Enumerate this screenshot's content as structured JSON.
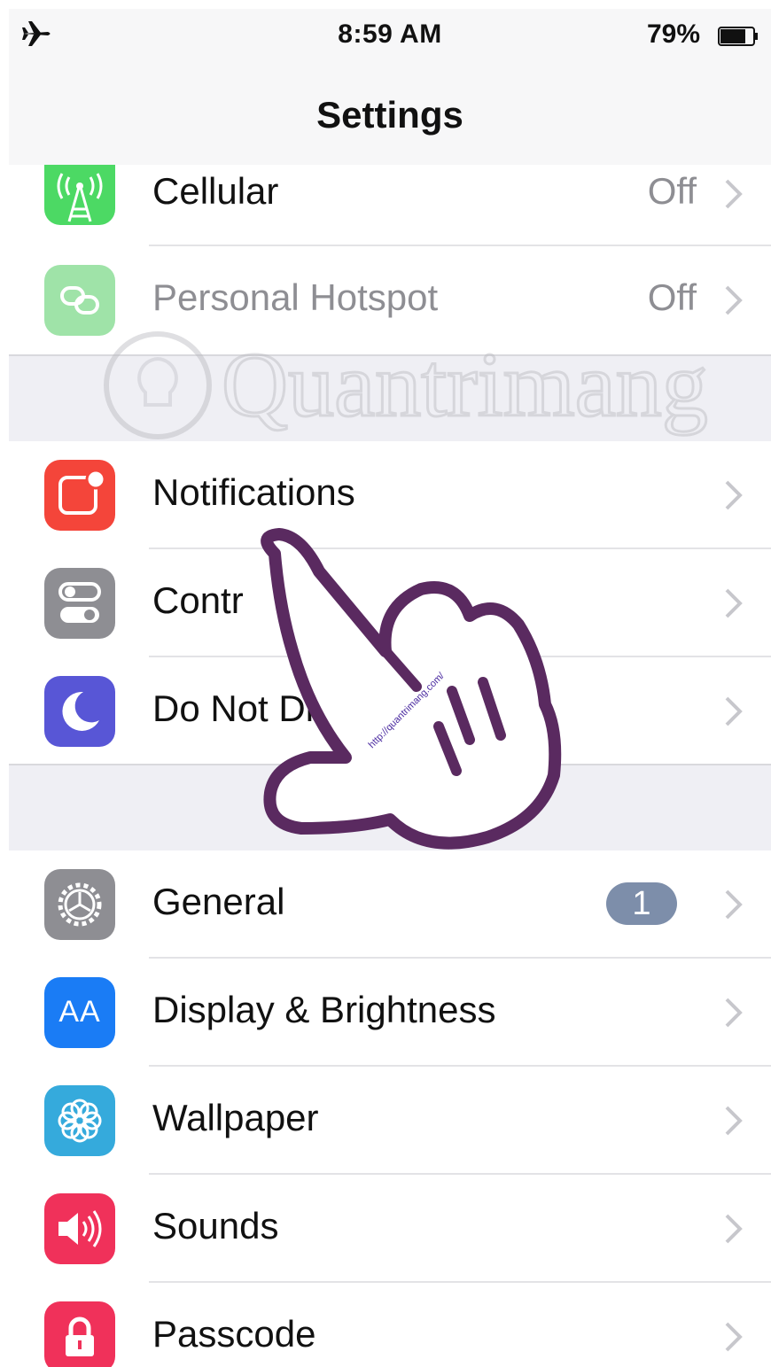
{
  "status_bar": {
    "time": "8:59 AM",
    "battery_percent": "79%",
    "battery_level": 0.79,
    "icons": [
      "airplane-icon",
      "battery-icon"
    ]
  },
  "navbar": {
    "title": "Settings"
  },
  "rows": {
    "cellular": {
      "label": "Cellular",
      "value": "Off",
      "icon": "cellular-antenna-icon",
      "color": "#4cd964"
    },
    "hotspot": {
      "label": "Personal Hotspot",
      "value": "Off",
      "icon": "hotspot-chain-icon",
      "color": "#9fe3a8"
    },
    "notifications": {
      "label": "Notifications",
      "icon": "notifications-icon",
      "color": "#f4453a"
    },
    "control_center": {
      "label": "Contr",
      "icon": "control-center-toggles-icon",
      "color": "#8e8e93"
    },
    "do_not_disturb": {
      "label": "Do Not Dis",
      "icon": "moon-icon",
      "color": "#5856d6"
    },
    "general": {
      "label": "General",
      "badge": "1",
      "icon": "gear-icon",
      "color": "#8e8e93"
    },
    "display": {
      "label": "Display & Brightness",
      "icon": "text-size-icon",
      "icon_text": "AA",
      "color": "#1a7cf5"
    },
    "wallpaper": {
      "label": "Wallpaper",
      "icon": "flower-icon",
      "color": "#35aadc"
    },
    "sounds": {
      "label": "Sounds",
      "icon": "speaker-icon",
      "color": "#f0315a"
    },
    "passcode": {
      "label": "Passcode",
      "icon": "lock-icon",
      "color": "#f0315a"
    }
  },
  "overlays": {
    "watermark_text": "Quantrimang",
    "hand_caption": "http://quantrimang.com/"
  }
}
